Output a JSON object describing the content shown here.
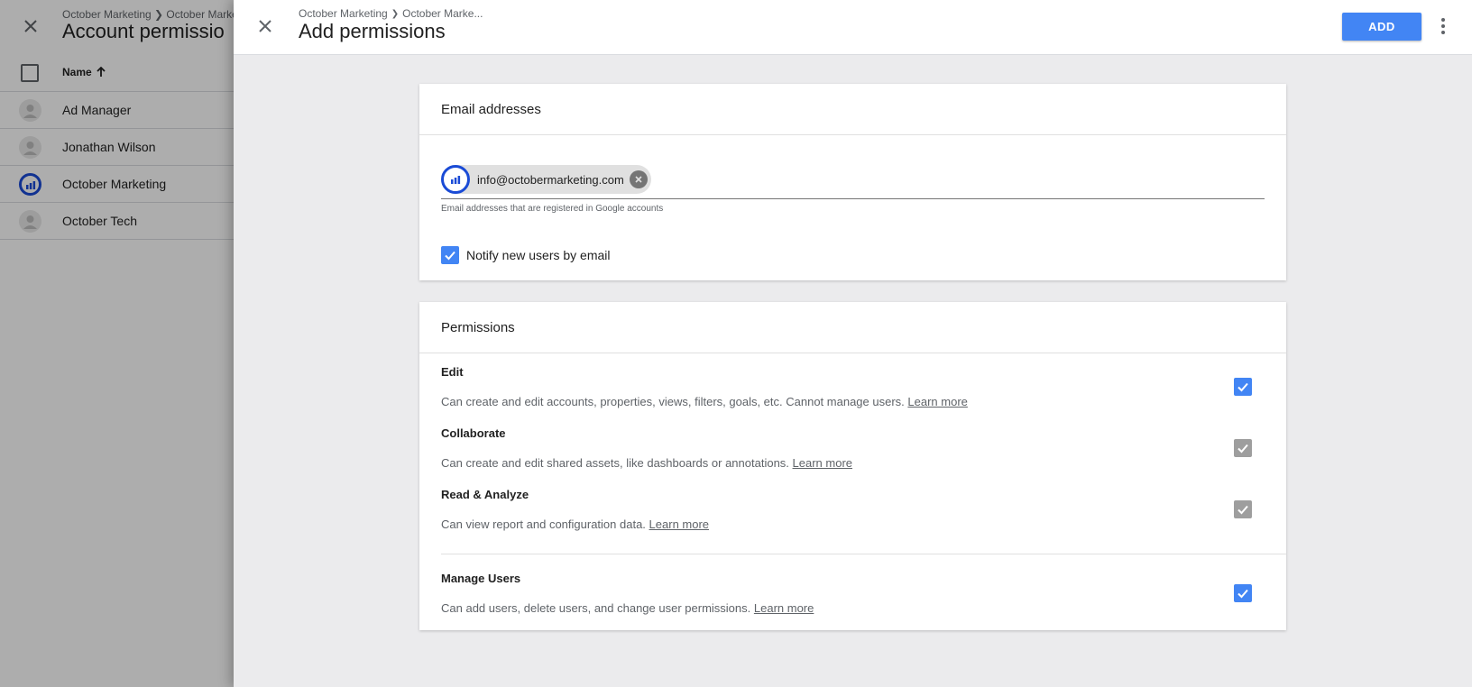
{
  "background": {
    "breadcrumb": "October Marketing ❯ October Marke",
    "title": "Account permissio",
    "column_name": "Name",
    "rows": [
      {
        "name": "Ad Manager"
      },
      {
        "name": "Jonathan Wilson"
      },
      {
        "name": "October Marketing"
      },
      {
        "name": "October Tech"
      }
    ]
  },
  "panel": {
    "breadcrumb_1": "October Marketing",
    "breadcrumb_sep": "❯",
    "breadcrumb_2": "October Marke...",
    "title": "Add permissions",
    "add_label": "ADD"
  },
  "email_section": {
    "title": "Email addresses",
    "chip_email": "info@octobermarketing.com",
    "hint": "Email addresses that are registered in Google accounts",
    "notify_label": "Notify new users by email",
    "notify_checked": true
  },
  "permissions_section": {
    "title": "Permissions",
    "learn_more": "Learn more",
    "items": [
      {
        "name": "Edit",
        "desc": "Can create and edit accounts, properties, views, filters, goals, etc. Cannot manage users.",
        "state": "checked"
      },
      {
        "name": "Collaborate",
        "desc": "Can create and edit shared assets, like dashboards or annotations.",
        "state": "disabled-checked"
      },
      {
        "name": "Read & Analyze",
        "desc": "Can view report and configuration data.",
        "state": "disabled-checked"
      },
      {
        "name": "Manage Users",
        "desc": "Can add users, delete users, and change user permissions.",
        "state": "checked"
      }
    ]
  },
  "colors": {
    "accent": "#4285f4",
    "brand_ring": "#1a4bd6",
    "disabled_check": "#9e9e9e"
  }
}
